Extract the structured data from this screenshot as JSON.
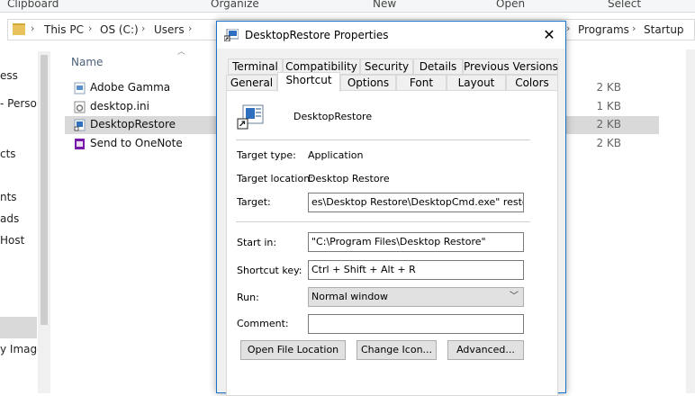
{
  "ribbon": {
    "groups": [
      "Clipboard",
      "Organize",
      "New",
      "Open",
      "Select"
    ]
  },
  "address": {
    "crumbs": [
      "This PC",
      "OS (C:)",
      "Users",
      "Programs",
      "Startup"
    ]
  },
  "nav": {
    "items": [
      "ess",
      "- Person",
      "cts",
      "nts",
      "ads",
      "Host",
      "y Image"
    ]
  },
  "filelist": {
    "column_name": "Name",
    "files": [
      {
        "name": "Adobe Gamma",
        "size": "2 KB",
        "icon": "shortcut-icon"
      },
      {
        "name": "desktop.ini",
        "size": "1 KB",
        "icon": "settings-file-icon"
      },
      {
        "name": "DesktopRestore",
        "size": "2 KB",
        "icon": "shortcut-icon",
        "selected": true
      },
      {
        "name": "Send to OneNote",
        "size": "2 KB",
        "icon": "onenote-icon"
      }
    ]
  },
  "dialog": {
    "title": "DesktopRestore Properties",
    "close": "✕",
    "tabs_row1": [
      "Terminal",
      "Compatibility",
      "Security",
      "Details",
      "Previous Versions"
    ],
    "tabs_row2": [
      "General",
      "Shortcut",
      "Options",
      "Font",
      "Layout",
      "Colors"
    ],
    "active_tab": "Shortcut",
    "shortcut_name": "DesktopRestore",
    "target_type_label": "Target type:",
    "target_type_value": "Application",
    "target_location_label": "Target location:",
    "target_location_value": "Desktop Restore",
    "target_label": "Target:",
    "target_value": "es\\Desktop Restore\\DesktopCmd.exe\" restore /y",
    "start_in_label": "Start in:",
    "start_in_value": "\"C:\\Program Files\\Desktop Restore\"",
    "shortcut_key_label": "Shortcut key:",
    "shortcut_key_value": "Ctrl + Shift + Alt + R",
    "run_label": "Run:",
    "run_value": "Normal window",
    "comment_label": "Comment:",
    "comment_value": "",
    "buttons": {
      "open_location": "Open File Location",
      "change_icon": "Change Icon...",
      "advanced": "Advanced..."
    }
  }
}
